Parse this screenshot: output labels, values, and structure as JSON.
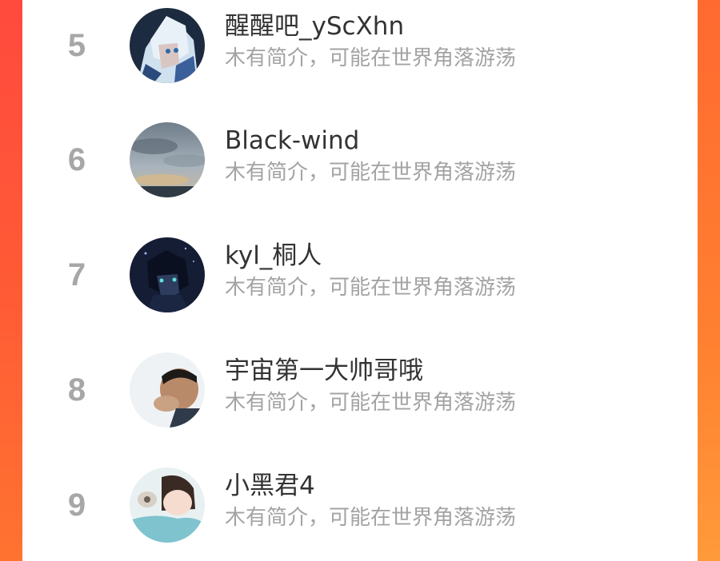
{
  "users": [
    {
      "rank": "5",
      "name": "醒醒吧_yScXhn",
      "bio": "木有简介，可能在世界角落游荡",
      "avatar": "anime-silver-hair-avatar"
    },
    {
      "rank": "6",
      "name": "Black-wind",
      "bio": "木有简介，可能在世界角落游荡",
      "avatar": "cloudy-sky-avatar"
    },
    {
      "rank": "7",
      "name": "kyl_桐人",
      "bio": "木有简介，可能在世界角落游荡",
      "avatar": "anime-dark-night-avatar"
    },
    {
      "rank": "8",
      "name": "宇宙第一大帅哥哦",
      "bio": "木有简介，可能在世界角落游荡",
      "avatar": "boy-photo-avatar"
    },
    {
      "rank": "9",
      "name": "小黑君4",
      "bio": "木有简介，可能在世界角落游荡",
      "avatar": "anime-girl-sleeping-avatar"
    }
  ]
}
